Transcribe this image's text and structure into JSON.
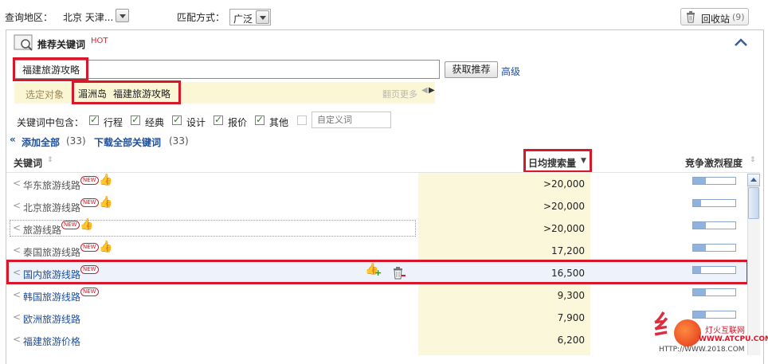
{
  "topbar": {
    "region_label": "查询地区：",
    "region_value": "北京 天津...",
    "match_label": "匹配方式：",
    "match_value": "广泛",
    "recycle_label": "回收站",
    "recycle_count": "(9)"
  },
  "panel": {
    "title": "推荐关键词",
    "hot": "HOT",
    "search_value": "福建旅游攻略",
    "get_button": "获取推荐",
    "advanced_link": "高级",
    "selected_label": "选定对象",
    "selected_items": [
      "湄洲岛",
      "福建旅游攻略"
    ],
    "page_more": "翻页更多"
  },
  "filters": {
    "label": "关键词中包含：",
    "options": [
      {
        "label": "行程",
        "checked": true
      },
      {
        "label": "经典",
        "checked": true
      },
      {
        "label": "设计",
        "checked": true
      },
      {
        "label": "报价",
        "checked": true
      },
      {
        "label": "其他",
        "checked": true
      }
    ],
    "custom_placeholder": "自定义词"
  },
  "actions": {
    "add_all": "添加全部",
    "add_all_count": "(33)",
    "download_all": "下载全部关键词",
    "download_count": "(33)"
  },
  "table": {
    "col_keyword": "关键词",
    "col_search": "日均搜索量",
    "col_competition": "竞争激烈程度",
    "rows": [
      {
        "keyword": "华东旅游线路",
        "new": "NEW",
        "thumb": true,
        "value": ">20,000",
        "competition": 0.3
      },
      {
        "keyword": "北京旅游线路",
        "new": "NEW",
        "thumb": true,
        "value": ">20,000",
        "competition": 0.18
      },
      {
        "keyword": "旅游线路",
        "new": "NEW",
        "thumb": true,
        "value": ">20,000",
        "competition": 0.3
      },
      {
        "keyword": "泰国旅游线路",
        "new": "NEW",
        "thumb": true,
        "value": "17,200",
        "competition": 0.3
      },
      {
        "keyword": "国内旅游线路",
        "new": "NEW",
        "thumb": false,
        "value": "16,500",
        "competition": 0.18
      },
      {
        "keyword": "韩国旅游线路",
        "new": "NEW",
        "thumb": false,
        "value": "9,300",
        "competition": 0.3
      },
      {
        "keyword": "欧洲旅游线路",
        "new": "",
        "thumb": false,
        "value": "7,900",
        "competition": 0.3
      },
      {
        "keyword": "福建旅游价格",
        "new": "",
        "thumb": false,
        "value": "6,200",
        "competition": 0.3
      }
    ]
  },
  "watermark": {
    "line1": "灯火互联网",
    "line2": "WWW.ATCPU.COM",
    "line3": "HTTP://WWW.2018.COM"
  },
  "colors": {
    "highlight_red": "#d6182a",
    "link_blue": "#1d4e9c",
    "yellow_bg": "#fbf7da"
  }
}
